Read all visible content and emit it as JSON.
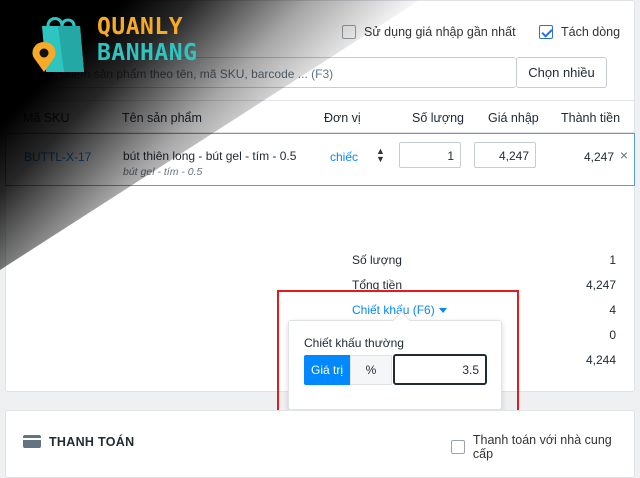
{
  "logo": {
    "line1": "QUANLY",
    "line2": "BANHANG"
  },
  "options": {
    "recent_price_label": "Sử dụng giá nhập gần nhất",
    "recent_price_checked": false,
    "split_lines_label": "Tách dòng",
    "split_lines_checked": true
  },
  "search": {
    "placeholder": "Tìm kiếm sản phẩm theo tên, mã SKU, barcode ... (F3)",
    "button_label": "Chọn nhiều"
  },
  "table": {
    "headers": {
      "sku": "Mã SKU",
      "name": "Tên sản phẩm",
      "unit": "Đơn vị",
      "qty": "Số lượng",
      "price": "Giá nhập",
      "total": "Thành tiền"
    },
    "rows": [
      {
        "sku": "BUTTL-X-17",
        "name": "bút thiên long - bút gel - tím - 0.5",
        "variant": "bút gel - tím - 0.5",
        "unit": "chiếc",
        "qty": "1",
        "price": "4,247",
        "total": "4,247"
      }
    ]
  },
  "summary": {
    "qty_label": "Số lượng",
    "qty_value": "1",
    "total_label": "Tổng tiền",
    "total_value": "4,247",
    "discount_label": "Chiết khấu (F6)",
    "discount_value": "4",
    "row4_value": "0",
    "final_value": "4,244"
  },
  "discount_popover": {
    "title": "Chiết khấu thường",
    "mode_value": "Giá trị",
    "mode_percent": "%",
    "amount": "3.5"
  },
  "payment": {
    "title": "THANH TOÁN",
    "supplier_label": "Thanh toán với nhà cung cấp",
    "supplier_checked": false
  },
  "colors": {
    "accent": "#0088ff",
    "highlight": "#e21c1c",
    "logo_orange": "#f7a928",
    "logo_teal": "#2ec4c0"
  }
}
